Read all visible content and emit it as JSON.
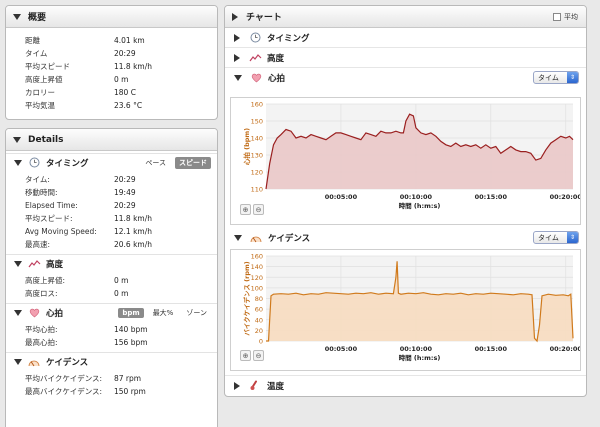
{
  "overview": {
    "title": "概要",
    "rows": [
      {
        "k": "距離",
        "v": "4.01 km"
      },
      {
        "k": "タイム",
        "v": "20:29"
      },
      {
        "k": "平均スピード",
        "v": "11.8 km/h"
      },
      {
        "k": "高度上昇値",
        "v": "0 m"
      },
      {
        "k": "カロリー",
        "v": "180 C"
      },
      {
        "k": "平均気温",
        "v": "23.6 °C"
      }
    ]
  },
  "details": {
    "title": "Details",
    "timing": {
      "title": "タイミング",
      "pace_label": "ペース",
      "speed_label": "スピード",
      "rows": [
        {
          "k": "タイム:",
          "v": "20:29"
        },
        {
          "k": "移動時間:",
          "v": "19:49"
        },
        {
          "k": "Elapsed Time:",
          "v": "20:29"
        },
        {
          "k": "平均スピード:",
          "v": "11.8 km/h"
        },
        {
          "k": "Avg Moving Speed:",
          "v": "12.1 km/h"
        },
        {
          "k": "最高速:",
          "v": "20.6 km/h"
        }
      ]
    },
    "elevation": {
      "title": "高度",
      "rows": [
        {
          "k": "高度上昇値:",
          "v": "0 m"
        },
        {
          "k": "高度ロス:",
          "v": "0 m"
        }
      ]
    },
    "heart": {
      "title": "心拍",
      "bpm_label": "bpm",
      "max_label": "最大%",
      "zone_label": "ゾーン",
      "rows": [
        {
          "k": "平均心拍:",
          "v": "140 bpm"
        },
        {
          "k": "最高心拍:",
          "v": "156 bpm"
        }
      ]
    },
    "cadence": {
      "title": "ケイデンス",
      "rows": [
        {
          "k": "平均バイクケイデンス:",
          "v": "87 rpm"
        },
        {
          "k": "最高バイクケイデンス:",
          "v": "150 rpm"
        }
      ]
    }
  },
  "charts": {
    "title": "チャート",
    "avg_label": "平均",
    "timing_label": "タイミング",
    "elevation_label": "高度",
    "heart_label": "心拍",
    "cadence_label": "ケイデンス",
    "temp_label": "温度",
    "select_value": "タイム"
  },
  "colors": {
    "heart_line": "#9a1f1f",
    "heart_fill": "#eac9c9",
    "cadence_line": "#d07a1c",
    "cadence_fill": "#f7dcc2",
    "axis_label": "#c06a14"
  },
  "chart_data": [
    {
      "type": "area",
      "ylabel": "心拍 (bpm)",
      "xlabel": "時間 (h:m:s)",
      "ylim": [
        110,
        160
      ],
      "yticks": [
        110,
        120,
        130,
        140,
        150,
        160
      ],
      "xlim": [
        0,
        1229
      ],
      "xticks": [
        {
          "t": 300,
          "label": "00:05:00"
        },
        {
          "t": 600,
          "label": "00:10:00"
        },
        {
          "t": 900,
          "label": "00:15:00"
        },
        {
          "t": 1200,
          "label": "00:20:00"
        }
      ],
      "series": [
        {
          "x": [
            0,
            15,
            30,
            45,
            60,
            80,
            100,
            120,
            140,
            160,
            180,
            200,
            220,
            240,
            260,
            280,
            300,
            320,
            340,
            360,
            380,
            400,
            420,
            440,
            460,
            480,
            500,
            520,
            540,
            550,
            560,
            575,
            590,
            600,
            620,
            640,
            660,
            680,
            700,
            720,
            740,
            760,
            780,
            800,
            820,
            840,
            860,
            880,
            900,
            920,
            940,
            960,
            980,
            1000,
            1020,
            1040,
            1060,
            1080,
            1100,
            1120,
            1140,
            1160,
            1180,
            1200,
            1215,
            1229
          ],
          "y": [
            110,
            125,
            136,
            140,
            142,
            145,
            144,
            140,
            141,
            140,
            142,
            141,
            140,
            139,
            141,
            143,
            143,
            142,
            141,
            140,
            139,
            143,
            142,
            141,
            144,
            143,
            143,
            144,
            143,
            143,
            150,
            154,
            153,
            146,
            143,
            142,
            143,
            141,
            138,
            136,
            135,
            137,
            135,
            136,
            135,
            136,
            134,
            136,
            134,
            135,
            131,
            133,
            135,
            133,
            132,
            132,
            131,
            127,
            128,
            133,
            137,
            139,
            141,
            140,
            141,
            139
          ]
        }
      ]
    },
    {
      "type": "area",
      "ylabel": "バイクケイデンス (rpm)",
      "xlabel": "時間 (h:m:s)",
      "ylim": [
        0,
        160
      ],
      "yticks": [
        0,
        20,
        40,
        60,
        80,
        100,
        120,
        140,
        160
      ],
      "xlim": [
        0,
        1229
      ],
      "xticks": [
        {
          "t": 300,
          "label": "00:05:00"
        },
        {
          "t": 600,
          "label": "00:10:00"
        },
        {
          "t": 900,
          "label": "00:15:00"
        },
        {
          "t": 1200,
          "label": "00:20:00"
        }
      ],
      "series": [
        {
          "x": [
            0,
            10,
            20,
            30,
            60,
            90,
            120,
            150,
            180,
            210,
            240,
            270,
            300,
            330,
            360,
            390,
            420,
            450,
            480,
            510,
            520,
            525,
            530,
            540,
            570,
            600,
            630,
            660,
            690,
            720,
            750,
            780,
            810,
            840,
            870,
            900,
            930,
            960,
            990,
            1020,
            1050,
            1065,
            1075,
            1085,
            1095,
            1105,
            1130,
            1160,
            1190,
            1210,
            1220,
            1229
          ],
          "y": [
            0,
            0,
            85,
            88,
            89,
            88,
            90,
            87,
            89,
            88,
            91,
            90,
            89,
            88,
            90,
            89,
            91,
            88,
            90,
            89,
            120,
            150,
            90,
            88,
            90,
            89,
            91,
            88,
            87,
            89,
            88,
            90,
            87,
            89,
            88,
            90,
            89,
            88,
            87,
            89,
            88,
            87,
            5,
            0,
            30,
            85,
            88,
            86,
            87,
            85,
            88,
            5
          ]
        }
      ]
    }
  ]
}
